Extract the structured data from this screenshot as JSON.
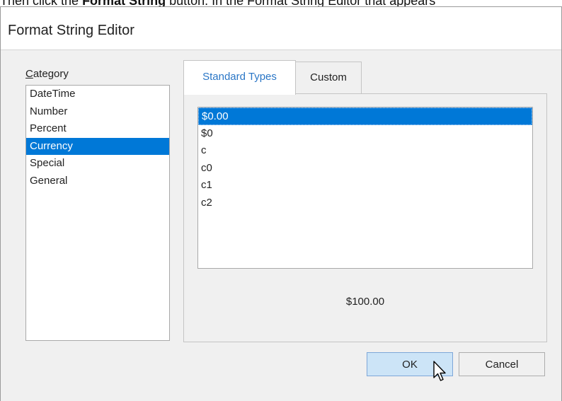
{
  "background_text": {
    "pre": "Then click the ",
    "bold": "Format String",
    "post": " button. In the Format String Editor that appears"
  },
  "dialog": {
    "title": "Format String Editor",
    "category_label_prefix": "",
    "category_label_accel": "C",
    "category_label_rest": "ategory",
    "categories": [
      "DateTime",
      "Number",
      "Percent",
      "Currency",
      "Special",
      "General"
    ],
    "selected_category": "Currency",
    "tabs": {
      "standard": "Standard Types",
      "custom": "Custom"
    },
    "active_tab": "Standard Types",
    "format_types": [
      "$0.00",
      "$0",
      "c",
      "c0",
      "c1",
      "c2"
    ],
    "selected_format": "$0.00",
    "preview": "$100.00",
    "ok_label": "OK",
    "cancel_label": "Cancel"
  },
  "colors": {
    "selection": "#0078d7",
    "active_tab_text": "#2a76c6",
    "ok_button": "#cce4f7"
  },
  "icons": [
    "arrow-cursor-icon"
  ]
}
